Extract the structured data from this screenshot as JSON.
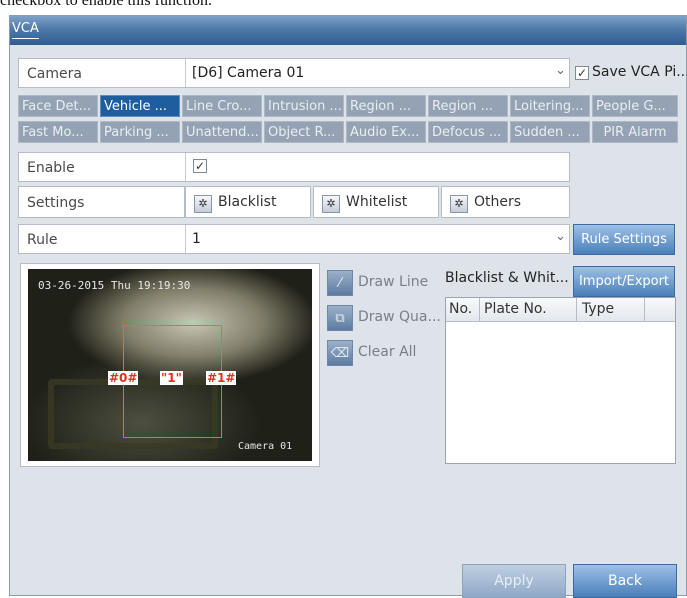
{
  "caption": "checkbox to enable this function.",
  "window": {
    "title": "VCA"
  },
  "camera": {
    "label": "Camera",
    "value": "[D6] Camera 01",
    "dropdown_arrow": "⌄",
    "save_checkbox": "✓",
    "save_label": "Save VCA Pi..."
  },
  "tabs_row1": [
    "Face Det...",
    "Vehicle ...",
    "Line Cro...",
    "Intrusion ...",
    "Region ...",
    "Region ...",
    "Loitering...",
    "People G..."
  ],
  "tabs_row2": [
    "Fast Mo...",
    "Parking ...",
    "Unattend...",
    "Object R...",
    "Audio Ex...",
    "Defocus ...",
    "Sudden ...",
    "PIR Alarm"
  ],
  "enable": {
    "label": "Enable",
    "check": "✓"
  },
  "settings": {
    "label": "Settings",
    "blacklist": "Blacklist",
    "whitelist": "Whitelist",
    "others": "Others",
    "gear": "✲"
  },
  "rule": {
    "label": "Rule",
    "value": "1",
    "dropdown_arrow": "⌄",
    "settings_button": "Rule Settings"
  },
  "video": {
    "timestamp": "03-26-2015 Thu 19:19:30",
    "camera_name": "Camera 01",
    "marker_left": "#0#",
    "marker_mid": "\"1\"",
    "marker_right": "#1#"
  },
  "tools": {
    "draw_line": "Draw Line",
    "draw_quad": "Draw Qua...",
    "clear_all": "Clear All",
    "line_icon": "⁄",
    "quad_icon": "⧉",
    "clear_icon": "⌫"
  },
  "list": {
    "title": "Blacklist & Whit...",
    "import_export": "Import/Export",
    "columns": [
      "No.",
      "Plate No.",
      "Type"
    ],
    "rows": []
  },
  "footer": {
    "apply": "Apply",
    "back": "Back"
  },
  "colors": {
    "accent": "#1e5d9e",
    "titlebar": "#4f79a8",
    "panel": "#dee3ea",
    "roi_green": "#32c832",
    "marker_red": "#e03020"
  }
}
